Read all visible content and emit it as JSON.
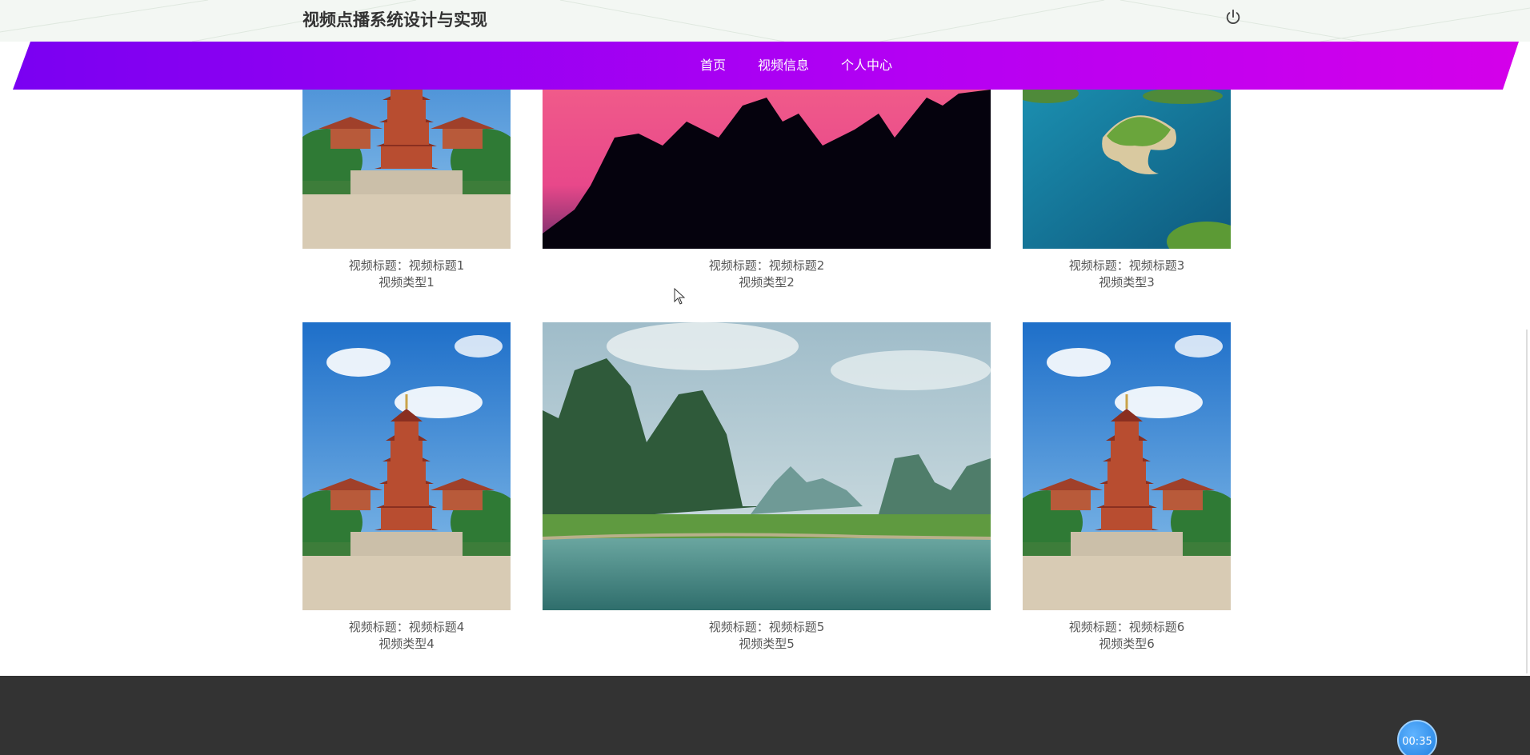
{
  "header": {
    "site_title": "视频点播系统设计与实现",
    "power_icon": "power-icon"
  },
  "nav": {
    "items": [
      {
        "label": "首页"
      },
      {
        "label": "视频信息"
      },
      {
        "label": "个人中心"
      }
    ]
  },
  "videos": [
    {
      "title_line": "视频标题：视频标题1",
      "type_line": "视频类型1",
      "thumb": "pagoda"
    },
    {
      "title_line": "视频标题：视频标题2",
      "type_line": "视频类型2",
      "thumb": "mountain-silhouette-sunset"
    },
    {
      "title_line": "视频标题：视频标题3",
      "type_line": "视频类型3",
      "thumb": "lake-islands-aerial"
    },
    {
      "title_line": "视频标题：视频标题4",
      "type_line": "视频类型4",
      "thumb": "pagoda"
    },
    {
      "title_line": "视频标题：视频标题5",
      "type_line": "视频类型5",
      "thumb": "karst-river"
    },
    {
      "title_line": "视频标题：视频标题6",
      "type_line": "视频类型6",
      "thumb": "pagoda"
    }
  ],
  "timer": {
    "label": "00:35"
  },
  "colors": {
    "nav_start": "#7a00f2",
    "nav_end": "#d400ea",
    "footer": "#333333",
    "timer": "#1f7fe0"
  }
}
